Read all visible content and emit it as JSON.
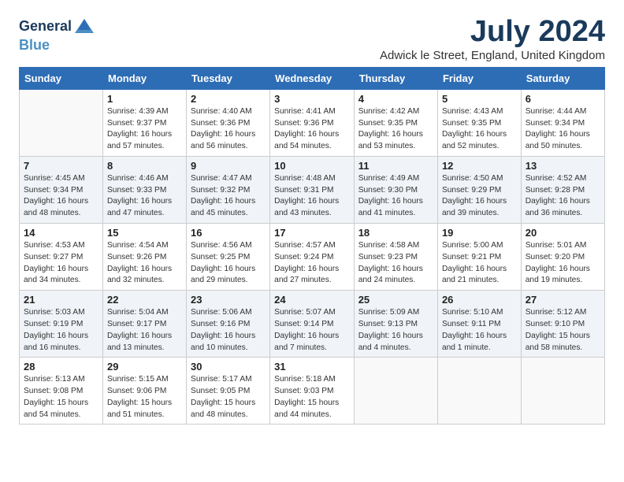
{
  "header": {
    "logo_line1": "General",
    "logo_line2": "Blue",
    "month": "July 2024",
    "location": "Adwick le Street, England, United Kingdom"
  },
  "weekdays": [
    "Sunday",
    "Monday",
    "Tuesday",
    "Wednesday",
    "Thursday",
    "Friday",
    "Saturday"
  ],
  "weeks": [
    [
      {
        "day": null,
        "info": null
      },
      {
        "day": "1",
        "info": "Sunrise: 4:39 AM\nSunset: 9:37 PM\nDaylight: 16 hours\nand 57 minutes."
      },
      {
        "day": "2",
        "info": "Sunrise: 4:40 AM\nSunset: 9:36 PM\nDaylight: 16 hours\nand 56 minutes."
      },
      {
        "day": "3",
        "info": "Sunrise: 4:41 AM\nSunset: 9:36 PM\nDaylight: 16 hours\nand 54 minutes."
      },
      {
        "day": "4",
        "info": "Sunrise: 4:42 AM\nSunset: 9:35 PM\nDaylight: 16 hours\nand 53 minutes."
      },
      {
        "day": "5",
        "info": "Sunrise: 4:43 AM\nSunset: 9:35 PM\nDaylight: 16 hours\nand 52 minutes."
      },
      {
        "day": "6",
        "info": "Sunrise: 4:44 AM\nSunset: 9:34 PM\nDaylight: 16 hours\nand 50 minutes."
      }
    ],
    [
      {
        "day": "7",
        "info": "Sunrise: 4:45 AM\nSunset: 9:34 PM\nDaylight: 16 hours\nand 48 minutes."
      },
      {
        "day": "8",
        "info": "Sunrise: 4:46 AM\nSunset: 9:33 PM\nDaylight: 16 hours\nand 47 minutes."
      },
      {
        "day": "9",
        "info": "Sunrise: 4:47 AM\nSunset: 9:32 PM\nDaylight: 16 hours\nand 45 minutes."
      },
      {
        "day": "10",
        "info": "Sunrise: 4:48 AM\nSunset: 9:31 PM\nDaylight: 16 hours\nand 43 minutes."
      },
      {
        "day": "11",
        "info": "Sunrise: 4:49 AM\nSunset: 9:30 PM\nDaylight: 16 hours\nand 41 minutes."
      },
      {
        "day": "12",
        "info": "Sunrise: 4:50 AM\nSunset: 9:29 PM\nDaylight: 16 hours\nand 39 minutes."
      },
      {
        "day": "13",
        "info": "Sunrise: 4:52 AM\nSunset: 9:28 PM\nDaylight: 16 hours\nand 36 minutes."
      }
    ],
    [
      {
        "day": "14",
        "info": "Sunrise: 4:53 AM\nSunset: 9:27 PM\nDaylight: 16 hours\nand 34 minutes."
      },
      {
        "day": "15",
        "info": "Sunrise: 4:54 AM\nSunset: 9:26 PM\nDaylight: 16 hours\nand 32 minutes."
      },
      {
        "day": "16",
        "info": "Sunrise: 4:56 AM\nSunset: 9:25 PM\nDaylight: 16 hours\nand 29 minutes."
      },
      {
        "day": "17",
        "info": "Sunrise: 4:57 AM\nSunset: 9:24 PM\nDaylight: 16 hours\nand 27 minutes."
      },
      {
        "day": "18",
        "info": "Sunrise: 4:58 AM\nSunset: 9:23 PM\nDaylight: 16 hours\nand 24 minutes."
      },
      {
        "day": "19",
        "info": "Sunrise: 5:00 AM\nSunset: 9:21 PM\nDaylight: 16 hours\nand 21 minutes."
      },
      {
        "day": "20",
        "info": "Sunrise: 5:01 AM\nSunset: 9:20 PM\nDaylight: 16 hours\nand 19 minutes."
      }
    ],
    [
      {
        "day": "21",
        "info": "Sunrise: 5:03 AM\nSunset: 9:19 PM\nDaylight: 16 hours\nand 16 minutes."
      },
      {
        "day": "22",
        "info": "Sunrise: 5:04 AM\nSunset: 9:17 PM\nDaylight: 16 hours\nand 13 minutes."
      },
      {
        "day": "23",
        "info": "Sunrise: 5:06 AM\nSunset: 9:16 PM\nDaylight: 16 hours\nand 10 minutes."
      },
      {
        "day": "24",
        "info": "Sunrise: 5:07 AM\nSunset: 9:14 PM\nDaylight: 16 hours\nand 7 minutes."
      },
      {
        "day": "25",
        "info": "Sunrise: 5:09 AM\nSunset: 9:13 PM\nDaylight: 16 hours\nand 4 minutes."
      },
      {
        "day": "26",
        "info": "Sunrise: 5:10 AM\nSunset: 9:11 PM\nDaylight: 16 hours\nand 1 minute."
      },
      {
        "day": "27",
        "info": "Sunrise: 5:12 AM\nSunset: 9:10 PM\nDaylight: 15 hours\nand 58 minutes."
      }
    ],
    [
      {
        "day": "28",
        "info": "Sunrise: 5:13 AM\nSunset: 9:08 PM\nDaylight: 15 hours\nand 54 minutes."
      },
      {
        "day": "29",
        "info": "Sunrise: 5:15 AM\nSunset: 9:06 PM\nDaylight: 15 hours\nand 51 minutes."
      },
      {
        "day": "30",
        "info": "Sunrise: 5:17 AM\nSunset: 9:05 PM\nDaylight: 15 hours\nand 48 minutes."
      },
      {
        "day": "31",
        "info": "Sunrise: 5:18 AM\nSunset: 9:03 PM\nDaylight: 15 hours\nand 44 minutes."
      },
      {
        "day": null,
        "info": null
      },
      {
        "day": null,
        "info": null
      },
      {
        "day": null,
        "info": null
      }
    ]
  ]
}
